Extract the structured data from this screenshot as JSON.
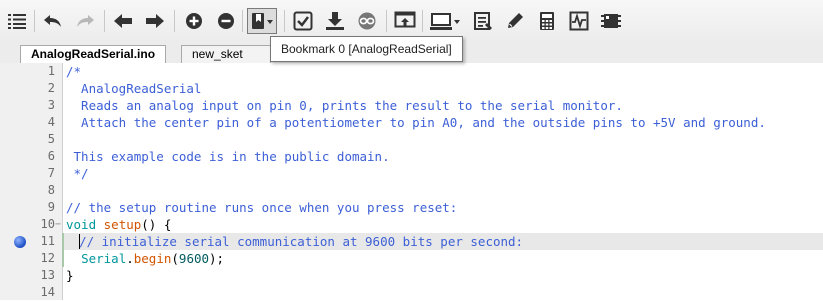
{
  "toolbar": {
    "buttons": [
      {
        "name": "menu-icon"
      },
      {
        "name": "undo-icon"
      },
      {
        "name": "redo-icon"
      },
      {
        "name": "arrow-left-icon"
      },
      {
        "name": "arrow-right-icon"
      },
      {
        "name": "plus-circle-icon"
      },
      {
        "name": "minus-circle-icon"
      },
      {
        "name": "bookmark-icon"
      },
      {
        "name": "verify-icon"
      },
      {
        "name": "upload-icon"
      },
      {
        "name": "arduino-icon"
      },
      {
        "name": "serial-monitor-icon"
      },
      {
        "name": "board-icon"
      },
      {
        "name": "document-list-icon"
      },
      {
        "name": "pencil-icon"
      },
      {
        "name": "calculator-icon"
      },
      {
        "name": "waveform-icon"
      },
      {
        "name": "chip-icon"
      }
    ]
  },
  "tabs": [
    {
      "label": "AnalogReadSerial.ino",
      "active": true
    },
    {
      "label": "new_sket",
      "active": false
    }
  ],
  "tooltip": {
    "text": "Bookmark 0 [AnalogReadSerial]"
  },
  "editor": {
    "current_line": 11,
    "bookmarked_line": 11,
    "lines": [
      {
        "n": "1",
        "text": "/*"
      },
      {
        "n": "2",
        "text": "  AnalogReadSerial"
      },
      {
        "n": "3",
        "text": "  Reads an analog input on pin 0, prints the result to the serial monitor."
      },
      {
        "n": "4",
        "text": "  Attach the center pin of a potentiometer to pin A0, and the outside pins to +5V and ground."
      },
      {
        "n": "5",
        "text": ""
      },
      {
        "n": "6",
        "text": " This example code is in the public domain."
      },
      {
        "n": "7",
        "text": " */"
      },
      {
        "n": "8",
        "text": ""
      },
      {
        "n": "9",
        "text": "// the setup routine runs once when you press reset:"
      },
      {
        "n": "10",
        "text": "void setup() {"
      },
      {
        "n": "11",
        "text": "  // initialize serial communication at 9600 bits per second:"
      },
      {
        "n": "12",
        "text": "  Serial.begin(9600);"
      },
      {
        "n": "13",
        "text": "}"
      },
      {
        "n": "14",
        "text": ""
      }
    ]
  },
  "colors": {
    "comment": "#3c5fd6",
    "function": "#d35400",
    "keyword": "#00979c",
    "number": "#005c5f",
    "bookmark": "#1d4fc4"
  }
}
